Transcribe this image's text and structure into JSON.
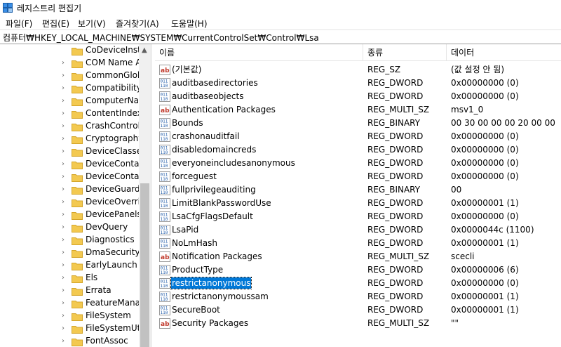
{
  "window": {
    "title": "레지스트리 편집기"
  },
  "menu": [
    "파일(F)",
    "편집(E)",
    "보기(V)",
    "즐겨찾기(A)",
    "도움말(H)"
  ],
  "address": {
    "path": "컴퓨터₩HKEY_LOCAL_MACHINE₩SYSTEM₩CurrentControlSet₩Control₩Lsa"
  },
  "tree": {
    "items": [
      {
        "label": "CoDeviceInsta",
        "expander": false
      },
      {
        "label": "COM Name A",
        "expander": true
      },
      {
        "label": "CommonGlob",
        "expander": true
      },
      {
        "label": "Compatibility",
        "expander": true
      },
      {
        "label": "ComputerNan",
        "expander": true
      },
      {
        "label": "ContentIndex",
        "expander": true
      },
      {
        "label": "CrashControl",
        "expander": true
      },
      {
        "label": "Cryptography",
        "expander": true
      },
      {
        "label": "DeviceClasses",
        "expander": true
      },
      {
        "label": "DeviceContair",
        "expander": true
      },
      {
        "label": "DeviceContair",
        "expander": true
      },
      {
        "label": "DeviceGuard",
        "expander": true
      },
      {
        "label": "DeviceOverrid",
        "expander": true
      },
      {
        "label": "DevicePanels",
        "expander": true
      },
      {
        "label": "DevQuery",
        "expander": true
      },
      {
        "label": "Diagnostics",
        "expander": true
      },
      {
        "label": "DmaSecurity",
        "expander": true
      },
      {
        "label": "EarlyLaunch",
        "expander": true
      },
      {
        "label": "Els",
        "expander": true
      },
      {
        "label": "Errata",
        "expander": true
      },
      {
        "label": "FeatureManag",
        "expander": true
      },
      {
        "label": "FileSystem",
        "expander": true
      },
      {
        "label": "FileSystemUtil",
        "expander": true
      },
      {
        "label": "FontAssoc",
        "expander": true
      }
    ]
  },
  "list": {
    "columns": [
      "이름",
      "종류",
      "데이터"
    ],
    "rows": [
      {
        "icon": "string-value-icon",
        "name": "(기본값)",
        "type": "REG_SZ",
        "data": "(값 설정 안 됨)"
      },
      {
        "icon": "binary-value-icon",
        "name": "auditbasedirectories",
        "type": "REG_DWORD",
        "data": "0x00000000 (0)"
      },
      {
        "icon": "binary-value-icon",
        "name": "auditbaseobjects",
        "type": "REG_DWORD",
        "data": "0x00000000 (0)"
      },
      {
        "icon": "string-value-icon",
        "name": "Authentication Packages",
        "type": "REG_MULTI_SZ",
        "data": "msv1_0"
      },
      {
        "icon": "binary-value-icon",
        "name": "Bounds",
        "type": "REG_BINARY",
        "data": "00 30 00 00 00 20 00 00"
      },
      {
        "icon": "binary-value-icon",
        "name": "crashonauditfail",
        "type": "REG_DWORD",
        "data": "0x00000000 (0)"
      },
      {
        "icon": "binary-value-icon",
        "name": "disabledomaincreds",
        "type": "REG_DWORD",
        "data": "0x00000000 (0)"
      },
      {
        "icon": "binary-value-icon",
        "name": "everyoneincludesanonymous",
        "type": "REG_DWORD",
        "data": "0x00000000 (0)"
      },
      {
        "icon": "binary-value-icon",
        "name": "forceguest",
        "type": "REG_DWORD",
        "data": "0x00000000 (0)"
      },
      {
        "icon": "binary-value-icon",
        "name": "fullprivilegeauditing",
        "type": "REG_BINARY",
        "data": "00"
      },
      {
        "icon": "binary-value-icon",
        "name": "LimitBlankPasswordUse",
        "type": "REG_DWORD",
        "data": "0x00000001 (1)"
      },
      {
        "icon": "binary-value-icon",
        "name": "LsaCfgFlagsDefault",
        "type": "REG_DWORD",
        "data": "0x00000000 (0)"
      },
      {
        "icon": "binary-value-icon",
        "name": "LsaPid",
        "type": "REG_DWORD",
        "data": "0x0000044c (1100)"
      },
      {
        "icon": "binary-value-icon",
        "name": "NoLmHash",
        "type": "REG_DWORD",
        "data": "0x00000001 (1)"
      },
      {
        "icon": "string-value-icon",
        "name": "Notification Packages",
        "type": "REG_MULTI_SZ",
        "data": "scecli"
      },
      {
        "icon": "binary-value-icon",
        "name": "ProductType",
        "type": "REG_DWORD",
        "data": "0x00000006 (6)"
      },
      {
        "icon": "binary-value-icon",
        "name": "restrictanonymous",
        "type": "REG_DWORD",
        "data": "0x00000000 (0)",
        "selected": true
      },
      {
        "icon": "binary-value-icon",
        "name": "restrictanonymoussam",
        "type": "REG_DWORD",
        "data": "0x00000001 (1)"
      },
      {
        "icon": "binary-value-icon",
        "name": "SecureBoot",
        "type": "REG_DWORD",
        "data": "0x00000001 (1)"
      },
      {
        "icon": "string-value-icon",
        "name": "Security Packages",
        "type": "REG_MULTI_SZ",
        "data": "\"\""
      }
    ]
  },
  "colors": {
    "selection": "#0078d7",
    "folder": "#f3c950",
    "string_icon": "#c0392b",
    "binary_icon": "#1e5aa8"
  }
}
